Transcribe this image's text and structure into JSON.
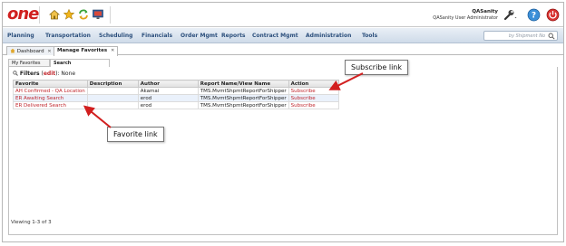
{
  "brand": {
    "logo": "one",
    "accent": "#d0201f"
  },
  "user": {
    "name": "QASanity",
    "role": "QASanity User Administrator"
  },
  "topbar_icons": [
    "home-icon",
    "star-icon",
    "refresh-icon",
    "monitor-icon"
  ],
  "tools": [
    "wrench-icon",
    "help-icon",
    "power-icon"
  ],
  "nav": {
    "items": [
      "Planning",
      "Transportation",
      "Scheduling",
      "Financials",
      "Order Mgmt",
      "Reports",
      "Contract Mgmt",
      "Administration",
      "Tools"
    ],
    "search_placeholder": "by Shipment No"
  },
  "doc_tabs": [
    {
      "label": "Dashboard",
      "active": false
    },
    {
      "label": "Manage Favorites",
      "active": true
    }
  ],
  "sub_tabs": [
    {
      "label": "My Favorites",
      "active": false
    },
    {
      "label": "Search",
      "active": true
    }
  ],
  "filters": {
    "label": "Filters",
    "edit": "edit",
    "suffix": ": None"
  },
  "table": {
    "columns": [
      "Favorite",
      "Description",
      "Author",
      "Report Name/View Name",
      "Action"
    ],
    "rows": [
      {
        "favorite": "AH Confirmed - QA Location",
        "description": "",
        "author": "Akamai",
        "report": "TMS.MvmtShpmtReportForShipper",
        "action": "Subscribe"
      },
      {
        "favorite": "ER Awaiting Search",
        "description": "",
        "author": "erod",
        "report": "TMS.MvmtShpmtReportForShipper",
        "action": "Subscribe"
      },
      {
        "favorite": "ER Delivered Search",
        "description": "",
        "author": "erod",
        "report": "TMS.MvmtShpmtReportForShipper",
        "action": "Subscribe"
      }
    ]
  },
  "footer": {
    "viewing": "Viewing 1-3 of 3"
  },
  "callouts": {
    "subscribe": "Subscribe link",
    "favorite": "Favorite link"
  },
  "colors": {
    "link": "#c0262c",
    "callout_arrow": "#d21f1f",
    "nav_text": "#2c4f7c"
  }
}
